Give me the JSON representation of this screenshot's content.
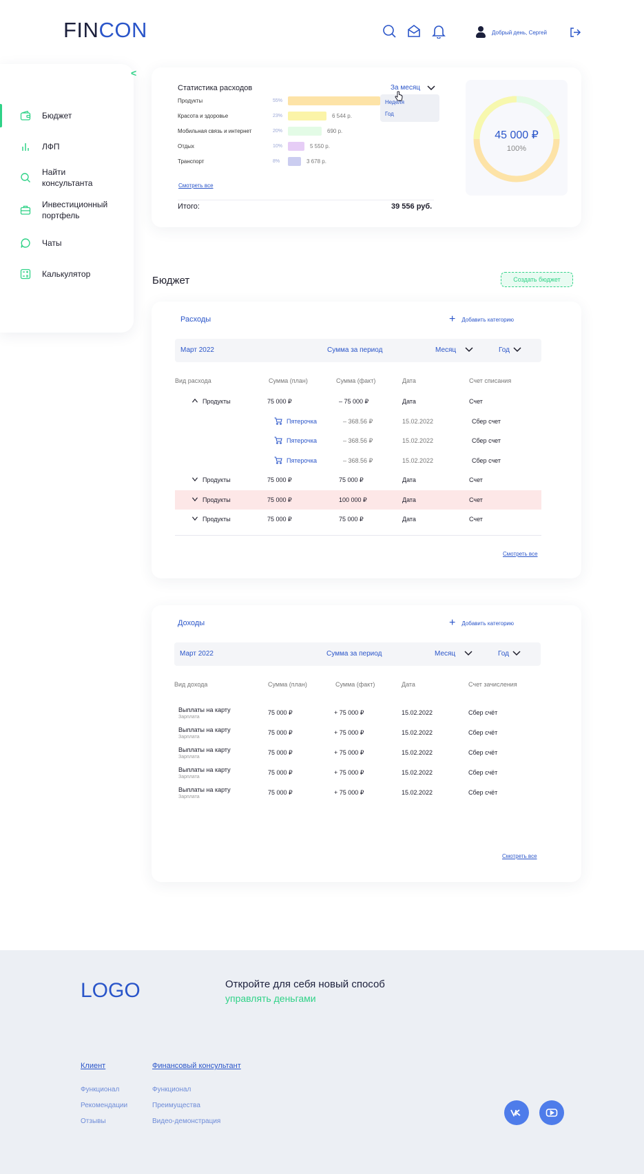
{
  "header": {
    "logo_part1": "FIN",
    "logo_part2": "CON",
    "greeting": "Добрый день, Сергей",
    "icons": [
      "search-icon",
      "mail-icon",
      "bell-icon",
      "user-icon",
      "logout-icon"
    ]
  },
  "sidebar": {
    "items": [
      {
        "label": "Бюджет",
        "icon": "wallet-icon",
        "active": true
      },
      {
        "label": "ЛФП",
        "icon": "bar-chart-icon"
      },
      {
        "label": "Найти консультанта",
        "icon": "search-icon"
      },
      {
        "label": "Инвестиционный портфель",
        "icon": "briefcase-icon"
      },
      {
        "label": "Чаты",
        "icon": "chat-icon"
      },
      {
        "label": "Калькулятор",
        "icon": "calculator-icon"
      }
    ]
  },
  "stats": {
    "title": "Статистика расходов",
    "period": "За месяц",
    "dropdown_options": [
      "Неделя",
      "Год"
    ],
    "categories": [
      {
        "name": "Продукты",
        "percent": "55%",
        "amount": "",
        "color": "#fde3a7",
        "share": 0.55
      },
      {
        "name": "Красота и здоровье",
        "percent": "23%",
        "amount": "6 544 р.",
        "color": "#fbf4a8",
        "share": 0.23
      },
      {
        "name": "Мобильная связь и интернет",
        "percent": "20%",
        "amount": "690 р.",
        "color": "#e3fbe6",
        "share": 0.2
      },
      {
        "name": "Отдых",
        "percent": "10%",
        "amount": "5 550 р.",
        "color": "#e6cdf6",
        "share": 0.1
      },
      {
        "name": "Транспорт",
        "percent": "8%",
        "amount": "3 678 р.",
        "color": "#cbcdf0",
        "share": 0.08
      }
    ],
    "see_all": "Смотреть все",
    "total_label": "Итого:",
    "total_value": "39 556 руб.",
    "donut_amount": "45 000 ₽",
    "donut_percent": "100%"
  },
  "budget": {
    "title": "Бюджет",
    "create_button": "Создать бюджет"
  },
  "expenses": {
    "title": "Расходы",
    "add_category": "Добавить категорию",
    "filter": {
      "period": "Март 2022",
      "sum": "Сумма за период",
      "month": "Месяц",
      "year": "Год"
    },
    "headers": [
      "Вид расхода",
      "Сумма (план)",
      "Сумма (факт)",
      "Дата",
      "Счет списания"
    ],
    "rows": [
      {
        "name": "Продукты",
        "plan": "75 000 ₽",
        "fact": "– 75 000 ₽",
        "date": "Дата",
        "account": "Счет",
        "expanded": true
      },
      {
        "name": "Пятерочка",
        "plan": "",
        "fact": "– 368.56 ₽",
        "date": "15.02.2022",
        "account": "Сбер счет",
        "sub": true
      },
      {
        "name": "Пятерочка",
        "plan": "",
        "fact": "– 368.56 ₽",
        "date": "15.02.2022",
        "account": "Сбер счет",
        "sub": true
      },
      {
        "name": "Пятерочка",
        "plan": "",
        "fact": "– 368.56 ₽",
        "date": "15.02.2022",
        "account": "Сбер счет",
        "sub": true
      },
      {
        "name": "Продукты",
        "plan": "75 000 ₽",
        "fact": "75 000 ₽",
        "date": "Дата",
        "account": "Счет"
      },
      {
        "name": "Продукты",
        "plan": "75 000 ₽",
        "fact": "100 000 ₽",
        "date": "Дата",
        "account": "Счет",
        "over": true
      },
      {
        "name": "Продукты",
        "plan": "75 000 ₽",
        "fact": "75 000 ₽",
        "date": "Дата",
        "account": "Счет"
      }
    ],
    "see_all": "Смотреть все"
  },
  "income": {
    "title": "Доходы",
    "add_category": "Добавить категорию",
    "filter": {
      "period": "Март 2022",
      "sum": "Сумма за период",
      "month": "Месяц",
      "year": "Год"
    },
    "headers": [
      "Вид дохода",
      "Сумма (план)",
      "Сумма (факт)",
      "Дата",
      "Счет зачисления"
    ],
    "rows": [
      {
        "name": "Выплаты на карту",
        "sub": "Зарплата",
        "plan": "75 000 ₽",
        "fact": "+ 75 000 ₽",
        "date": "15.02.2022",
        "account": "Сбер счёт"
      },
      {
        "name": "Выплаты на карту",
        "sub": "Зарплата",
        "plan": "75 000 ₽",
        "fact": "+ 75 000 ₽",
        "date": "15.02.2022",
        "account": "Сбер счёт"
      },
      {
        "name": "Выплаты на карту",
        "sub": "Зарплата",
        "plan": "75 000 ₽",
        "fact": "+ 75 000 ₽",
        "date": "15.02.2022",
        "account": "Сбер счёт"
      },
      {
        "name": "Выплаты на карту",
        "sub": "Зарплата",
        "plan": "75 000 ₽",
        "fact": "+ 75 000 ₽",
        "date": "15.02.2022",
        "account": "Сбер счёт"
      },
      {
        "name": "Выплаты на карту",
        "sub": "Зарплата",
        "plan": "75 000 ₽",
        "fact": "+ 75 000 ₽",
        "date": "15.02.2022",
        "account": "Сбер счёт"
      }
    ],
    "see_all": "Смотреть все"
  },
  "footer": {
    "logo": "LOGO",
    "tagline1": "Откройте для себя новый способ",
    "tagline2": "управлять деньгами",
    "client_title": "Клиент",
    "client_links": [
      "Функционал",
      "Рекомендации",
      "Отзывы"
    ],
    "consultant_title": "Финансовый консультант",
    "consultant_links": [
      "Функционал",
      "Преимущества",
      "Видео-демонстрация"
    ],
    "social": [
      "vk-icon",
      "youtube-icon"
    ]
  },
  "colors": {
    "accent": "#2a55c9",
    "green": "#2fd287",
    "over_row": "#fde7e7"
  }
}
